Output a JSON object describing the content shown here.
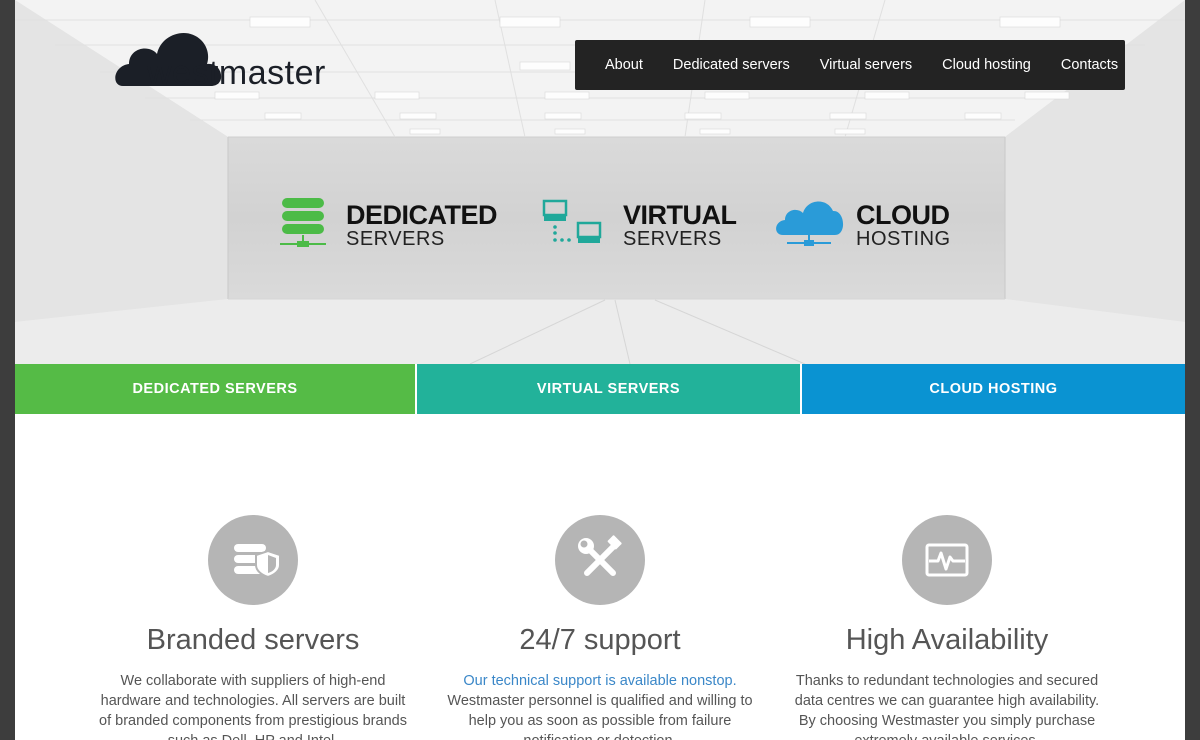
{
  "logo": {
    "text": "westmaster"
  },
  "nav": {
    "items": [
      {
        "label": "About"
      },
      {
        "label": "Dedicated servers"
      },
      {
        "label": "Virtual servers"
      },
      {
        "label": "Cloud hosting"
      },
      {
        "label": "Contacts"
      }
    ]
  },
  "hero": {
    "products": [
      {
        "title": "DEDICATED",
        "subtitle": "SERVERS",
        "icon": "server-stack-icon",
        "color": "#4cbb47"
      },
      {
        "title": "VIRTUAL",
        "subtitle": "SERVERS",
        "icon": "network-monitors-icon",
        "color": "#20a89a"
      },
      {
        "title": "CLOUD",
        "subtitle": "HOSTING",
        "icon": "cloud-network-icon",
        "color": "#2a9bd8"
      }
    ]
  },
  "categories": [
    {
      "label": "DEDICATED SERVERS",
      "color": "#55bb46"
    },
    {
      "label": "VIRTUAL SERVERS",
      "color": "#22b29a"
    },
    {
      "label": "CLOUD HOSTING",
      "color": "#0a93d2"
    }
  ],
  "features": [
    {
      "icon": "server-shield-icon",
      "title": "Branded servers",
      "link": "",
      "text": "We collaborate with suppliers of high-end hardware and technologies. All servers are built of branded components from prestigious brands such as Dell, HP and Intel."
    },
    {
      "icon": "tools-icon",
      "title": "24/7 support",
      "link": "Our technical support is available nonstop.",
      "text": "Westmaster personnel is qualified and willing to help you as soon as possible from failure notification or detection."
    },
    {
      "icon": "pulse-monitor-icon",
      "title": "High Availability",
      "link": "",
      "text": "Thanks to redundant technologies and secured data centres we can guarantee high availability. By choosing Westmaster you simply purchase extremely available services."
    }
  ]
}
